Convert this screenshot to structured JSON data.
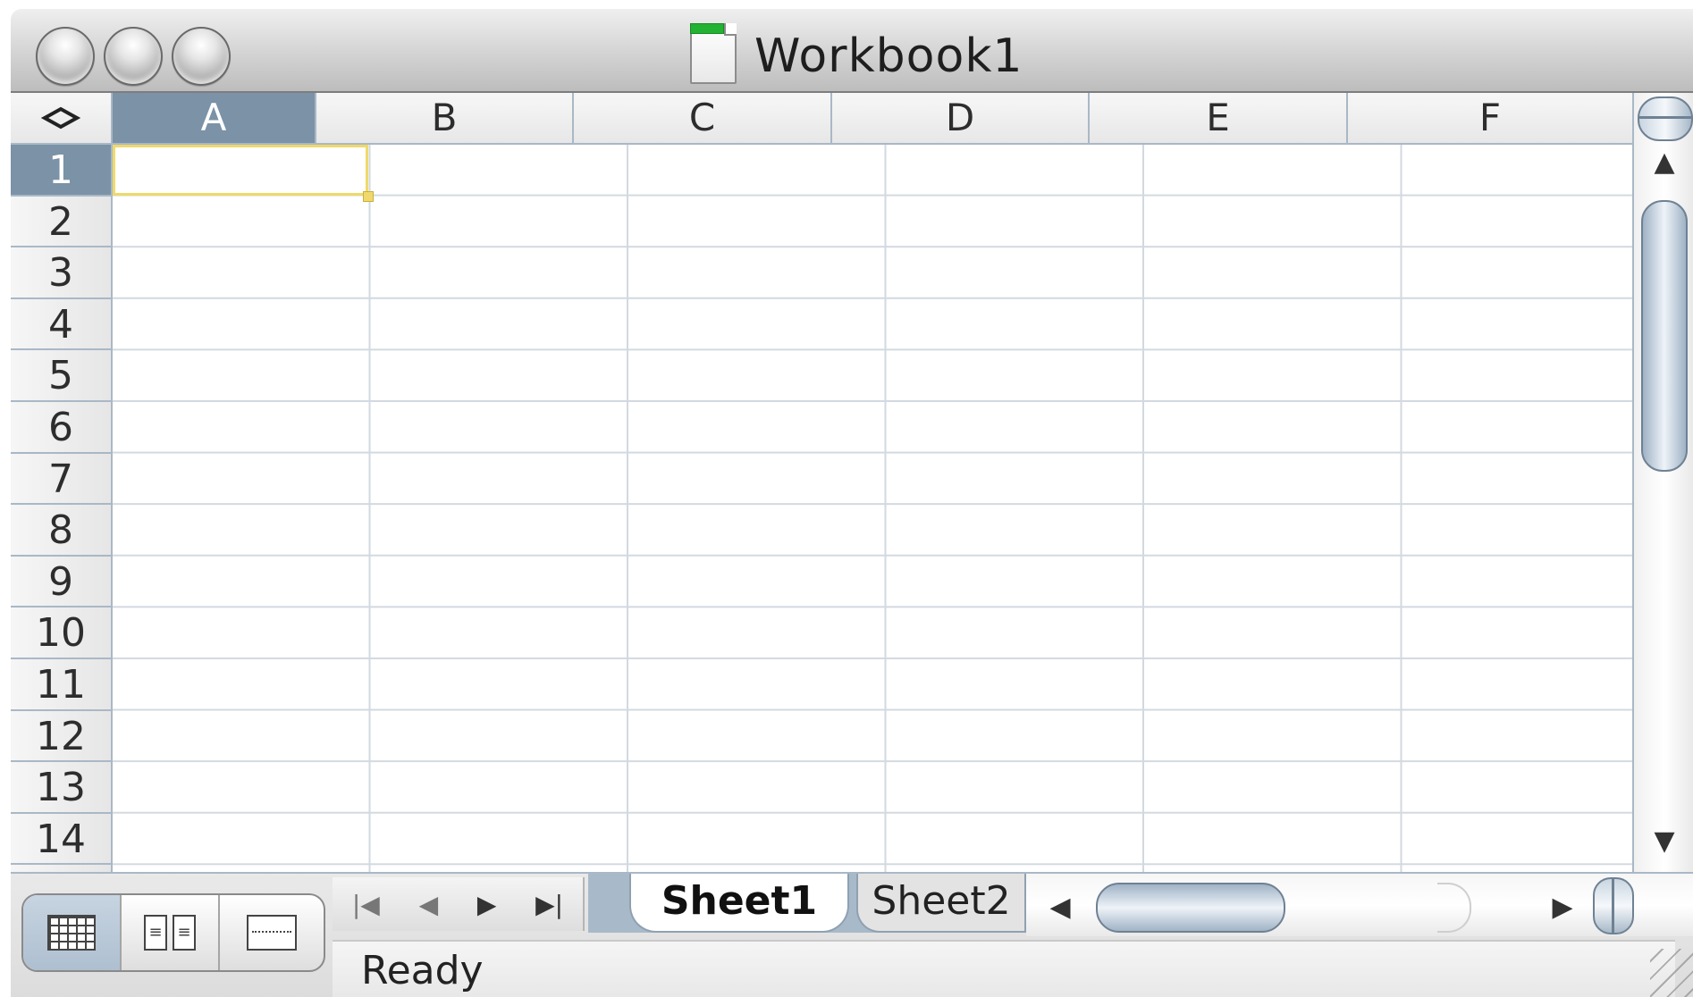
{
  "window": {
    "title": "Workbook1",
    "buttons": [
      "close",
      "minimize",
      "zoom"
    ]
  },
  "sheet": {
    "select_all_icon": "diamond-icon",
    "columns": [
      "A",
      "B",
      "C",
      "D",
      "E",
      "F"
    ],
    "rows": [
      "1",
      "2",
      "3",
      "4",
      "5",
      "6",
      "7",
      "8",
      "9",
      "10",
      "11",
      "12",
      "13",
      "14"
    ],
    "active_cell": "A1"
  },
  "tab_nav": {
    "first": "|◀",
    "prev": "◀",
    "next": "▶",
    "last": "▶|"
  },
  "tabs": [
    "Sheet1",
    "Sheet2"
  ],
  "active_tab": "Sheet1",
  "scroll": {
    "up": "▲",
    "down": "▼",
    "left": "◀",
    "right": "▶"
  },
  "view_buttons": [
    "normal-view-icon",
    "page-layout-view-icon",
    "page-break-preview-icon"
  ],
  "status": "Ready",
  "colors": {
    "selection_header": "#7b92a7",
    "active_cell_border": "#f0d96a",
    "gridline": "#d2d9e0",
    "tab_strip": "#a8bac9"
  }
}
